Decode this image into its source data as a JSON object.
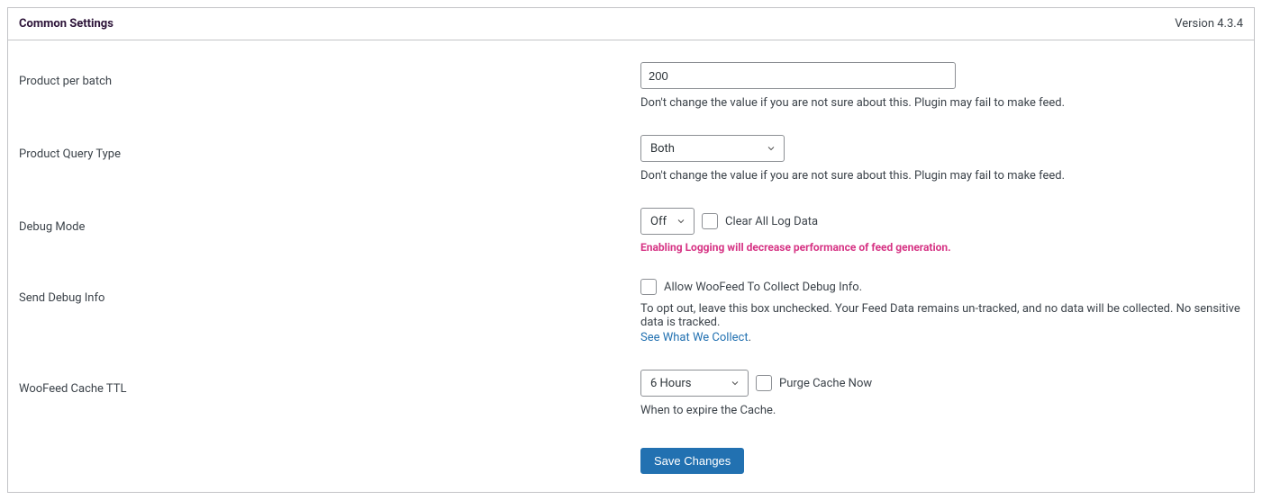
{
  "header": {
    "title": "Common Settings",
    "version": "Version 4.3.4"
  },
  "fields": {
    "product_per_batch": {
      "label": "Product per batch",
      "value": "200",
      "help": "Don't change the value if you are not sure about this. Plugin may fail to make feed."
    },
    "product_query_type": {
      "label": "Product Query Type",
      "value": "Both",
      "help": "Don't change the value if you are not sure about this. Plugin may fail to make feed."
    },
    "debug_mode": {
      "label": "Debug Mode",
      "value": "Off",
      "clear_log_label": "Clear All Log Data",
      "warn": "Enabling Logging will decrease performance of feed generation."
    },
    "send_debug_info": {
      "label": "Send Debug Info",
      "checkbox_label": "Allow WooFeed To Collect Debug Info.",
      "help": "To opt out, leave this box unchecked. Your Feed Data remains un-tracked, and no data will be collected. No sensitive data is tracked.",
      "link_text": "See What We Collect"
    },
    "cache_ttl": {
      "label": "WooFeed Cache TTL",
      "value": "6 Hours",
      "purge_label": "Purge Cache Now",
      "help": "When to expire the Cache."
    }
  },
  "submit": {
    "label": "Save Changes"
  }
}
